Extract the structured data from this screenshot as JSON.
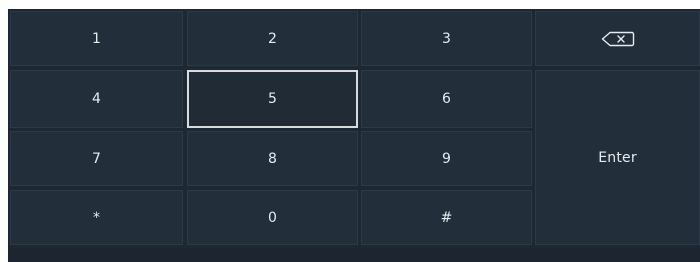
{
  "keypad": {
    "keys": {
      "k1": "1",
      "k2": "2",
      "k3": "3",
      "k4": "4",
      "k5": "5",
      "k6": "6",
      "k7": "7",
      "k8": "8",
      "k9": "9",
      "kstar": "*",
      "k0": "0",
      "khash": "#"
    },
    "enter_label": "Enter",
    "backspace_icon": "backspace-icon",
    "selected_key": "5"
  },
  "colors": {
    "background": "#1e2833",
    "key": "#222e3a",
    "key_border": "#2c3947",
    "text": "#e6ebf0",
    "selected_border": "#d6dbe0"
  }
}
